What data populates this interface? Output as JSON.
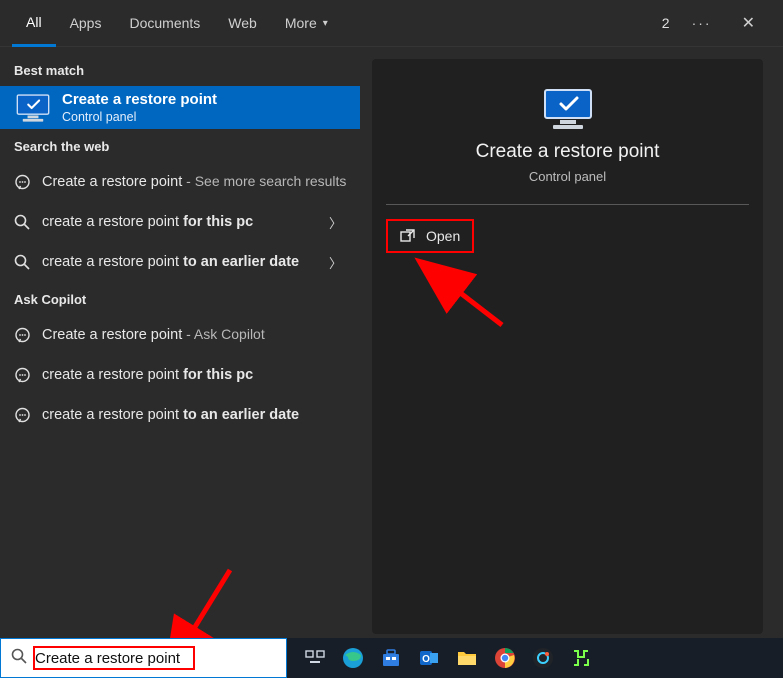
{
  "tabs": {
    "all": "All",
    "apps": "Apps",
    "documents": "Documents",
    "web": "Web",
    "more": "More"
  },
  "top_right": {
    "count": "2",
    "more": "···",
    "close": "✕"
  },
  "sections": {
    "best_match": "Best match",
    "search_web": "Search the web",
    "ask_copilot": "Ask Copilot"
  },
  "best_match": {
    "title": "Create a restore point",
    "subtitle": "Control panel"
  },
  "web_results": [
    {
      "text": "Create a restore point",
      "suffix": " - See more search results",
      "bold_suffix": "",
      "chev": false,
      "icon": "chat"
    },
    {
      "text": "create a restore point ",
      "bold_suffix": "for this pc",
      "suffix": "",
      "chev": true,
      "icon": "magnify"
    },
    {
      "text": "create a restore point ",
      "bold_suffix": "to an earlier date",
      "suffix": "",
      "chev": true,
      "icon": "magnify"
    }
  ],
  "copilot_results": [
    {
      "text": "Create a restore point",
      "suffix": " - Ask Copilot",
      "bold_suffix": ""
    },
    {
      "text": "create a restore point ",
      "bold_suffix": "for this pc",
      "suffix": ""
    },
    {
      "text": "create a restore point ",
      "bold_suffix": "to an earlier date",
      "suffix": ""
    }
  ],
  "preview": {
    "title": "Create a restore point",
    "subtitle": "Control panel",
    "open_label": "Open"
  },
  "search_box": {
    "value": "Create a restore point"
  }
}
